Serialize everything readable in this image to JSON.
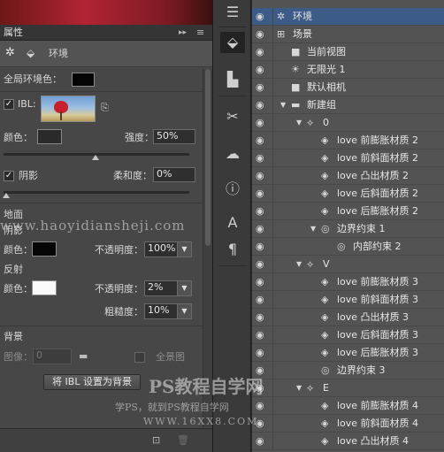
{
  "properties_panel": {
    "title": "属性",
    "collapse_glyph": "▸▸",
    "menu_glyph": "≡",
    "tab_label": "环境",
    "global_ambient_label": "全局环境色：",
    "ibl_label": "IBL:",
    "ibl_checked": true,
    "color_label": "颜色：",
    "intensity_label": "强度：",
    "intensity_value": "50%",
    "shadow_label": "阴影",
    "shadow_checked": true,
    "softness_label": "柔和度：",
    "softness_value": "0%",
    "ground_label": "地面",
    "ground_shadow_label": "阴影",
    "ground_color_label": "颜色：",
    "ground_opacity_label": "不透明度：",
    "ground_opacity_value": "100%",
    "reflect_label": "反射",
    "reflect_color_label": "颜色：",
    "reflect_opacity_label": "不透明度：",
    "reflect_opacity_value": "2%",
    "roughness_label": "粗糙度：",
    "roughness_value": "10%",
    "background_label": "背景",
    "image_label": "图像：",
    "image_value": "0",
    "panorama_label": "全景图",
    "set_ibl_bg_button": "将 IBL 设置为背景"
  },
  "watermark": {
    "url_text": "www.haoyidiansheji.com",
    "brand_text": "PS教程自学网",
    "slogan_text": "学PS，就到PS教程自学网",
    "site_text": "WWW.16XX8.COM"
  },
  "scene_tree": [
    {
      "label": "环境",
      "depth": 0,
      "icon": "environment-icon",
      "glyph": "✲",
      "selected": true,
      "expander": ""
    },
    {
      "label": "场景",
      "depth": 0,
      "icon": "scene-icon",
      "glyph": "⊞",
      "selected": false,
      "expander": ""
    },
    {
      "label": "当前视图",
      "depth": 1,
      "icon": "camera-icon",
      "glyph": "■",
      "selected": false,
      "expander": ""
    },
    {
      "label": "无限光 1",
      "depth": 1,
      "icon": "light-icon",
      "glyph": "☀",
      "selected": false,
      "expander": ""
    },
    {
      "label": "默认相机",
      "depth": 1,
      "icon": "camera-icon",
      "glyph": "■",
      "selected": false,
      "expander": ""
    },
    {
      "label": "新建组",
      "depth": 1,
      "icon": "folder-icon",
      "glyph": "▬",
      "selected": false,
      "expander": "▼"
    },
    {
      "label": "0",
      "depth": 2,
      "icon": "mesh-icon",
      "glyph": "⟡",
      "selected": false,
      "expander": "▼"
    },
    {
      "label": "love 前膨胀材质 2",
      "depth": 3,
      "icon": "material-icon",
      "glyph": "◈",
      "selected": false,
      "expander": ""
    },
    {
      "label": "love 前斜面材质 2",
      "depth": 3,
      "icon": "material-icon",
      "glyph": "◈",
      "selected": false,
      "expander": ""
    },
    {
      "label": "love 凸出材质 2",
      "depth": 3,
      "icon": "material-icon",
      "glyph": "◈",
      "selected": false,
      "expander": ""
    },
    {
      "label": "love 后斜面材质 2",
      "depth": 3,
      "icon": "material-icon",
      "glyph": "◈",
      "selected": false,
      "expander": ""
    },
    {
      "label": "love 后膨胀材质 2",
      "depth": 3,
      "icon": "material-icon",
      "glyph": "◈",
      "selected": false,
      "expander": ""
    },
    {
      "label": "边界约束 1",
      "depth": 3,
      "icon": "constraint-icon",
      "glyph": "◎",
      "selected": false,
      "expander": "▼"
    },
    {
      "label": "内部约束 2",
      "depth": 4,
      "icon": "constraint-icon",
      "glyph": "◎",
      "selected": false,
      "expander": ""
    },
    {
      "label": "V",
      "depth": 2,
      "icon": "mesh-icon",
      "glyph": "⟡",
      "selected": false,
      "expander": "▼"
    },
    {
      "label": "love 前膨胀材质 3",
      "depth": 3,
      "icon": "material-icon",
      "glyph": "◈",
      "selected": false,
      "expander": ""
    },
    {
      "label": "love 前斜面材质 3",
      "depth": 3,
      "icon": "material-icon",
      "glyph": "◈",
      "selected": false,
      "expander": ""
    },
    {
      "label": "love 凸出材质 3",
      "depth": 3,
      "icon": "material-icon",
      "glyph": "◈",
      "selected": false,
      "expander": ""
    },
    {
      "label": "love 后斜面材质 3",
      "depth": 3,
      "icon": "material-icon",
      "glyph": "◈",
      "selected": false,
      "expander": ""
    },
    {
      "label": "love 后膨胀材质 3",
      "depth": 3,
      "icon": "material-icon",
      "glyph": "◈",
      "selected": false,
      "expander": ""
    },
    {
      "label": "边界约束 3",
      "depth": 3,
      "icon": "constraint-icon",
      "glyph": "◎",
      "selected": false,
      "expander": ""
    },
    {
      "label": "E",
      "depth": 2,
      "icon": "mesh-icon",
      "glyph": "⟡",
      "selected": false,
      "expander": "▼"
    },
    {
      "label": "love 前膨胀材质 4",
      "depth": 3,
      "icon": "material-icon",
      "glyph": "◈",
      "selected": false,
      "expander": ""
    },
    {
      "label": "love 前斜面材质 4",
      "depth": 3,
      "icon": "material-icon",
      "glyph": "◈",
      "selected": false,
      "expander": ""
    },
    {
      "label": "love 凸出材质 4",
      "depth": 3,
      "icon": "material-icon",
      "glyph": "◈",
      "selected": false,
      "expander": ""
    }
  ],
  "colors": {
    "panel_bg": "#474747",
    "tree_bg": "#535353",
    "selected_row": "#3d5b87",
    "ground_color": "#000000",
    "reflect_color": "#ffffff"
  }
}
